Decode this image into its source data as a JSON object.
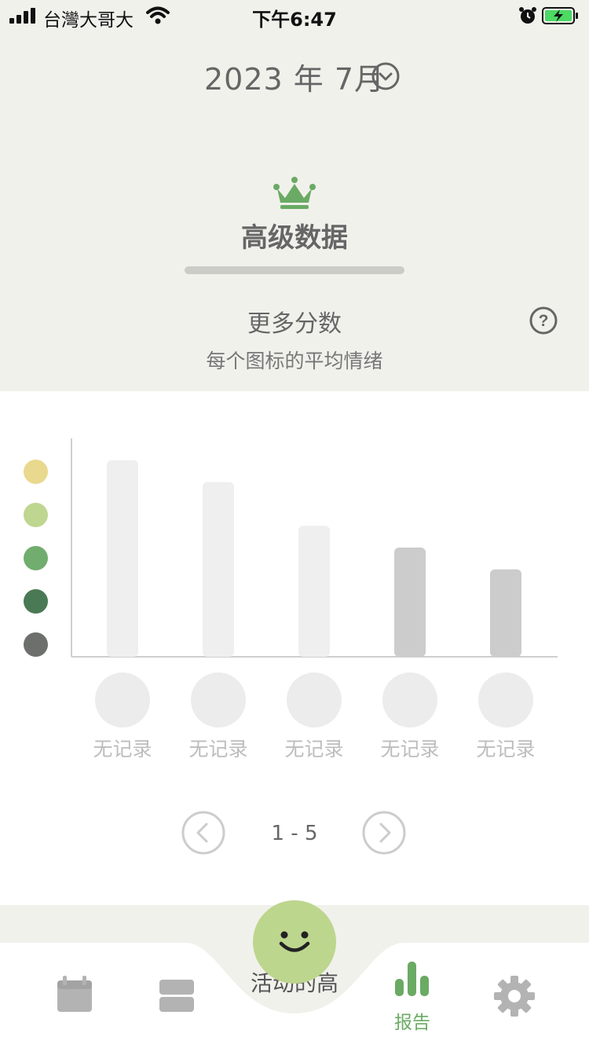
{
  "status_bar": {
    "carrier": "台灣大哥大",
    "time": "下午6:47"
  },
  "header": {
    "month_label": "2023 年 7月",
    "toggle_icon": "chevron-down-circle-icon"
  },
  "premium": {
    "icon": "crown-icon",
    "title": "高级数据"
  },
  "section": {
    "title": "更多分数",
    "subtitle": "每个图标的平均情绪",
    "help_icon": "question-circle-icon"
  },
  "mood_scale": {
    "colors": [
      "#e9d98e",
      "#bfd690",
      "#71ad6e",
      "#4a7a55",
      "#6d6f6d"
    ]
  },
  "chart_data": {
    "type": "bar",
    "categories": [
      "无记录",
      "无记录",
      "无记录",
      "无记录",
      "无记录"
    ],
    "values": [
      4.5,
      4.0,
      3.0,
      2.5,
      2.0
    ],
    "ylim": [
      0,
      5
    ],
    "bar_colors": [
      "#efefef",
      "#efefef",
      "#efefef",
      "#cccccc",
      "#cccccc"
    ],
    "grid": false
  },
  "pager": {
    "range": "1 - 5",
    "prev_icon": "chevron-left-circle-icon",
    "next_icon": "chevron-right-circle-icon"
  },
  "tab_bar": {
    "peek_text": "活动的高",
    "report_label": "报告",
    "accent": "#6aaa64",
    "inactive": "#b3b3b3",
    "fab_color": "#bdd68e"
  }
}
